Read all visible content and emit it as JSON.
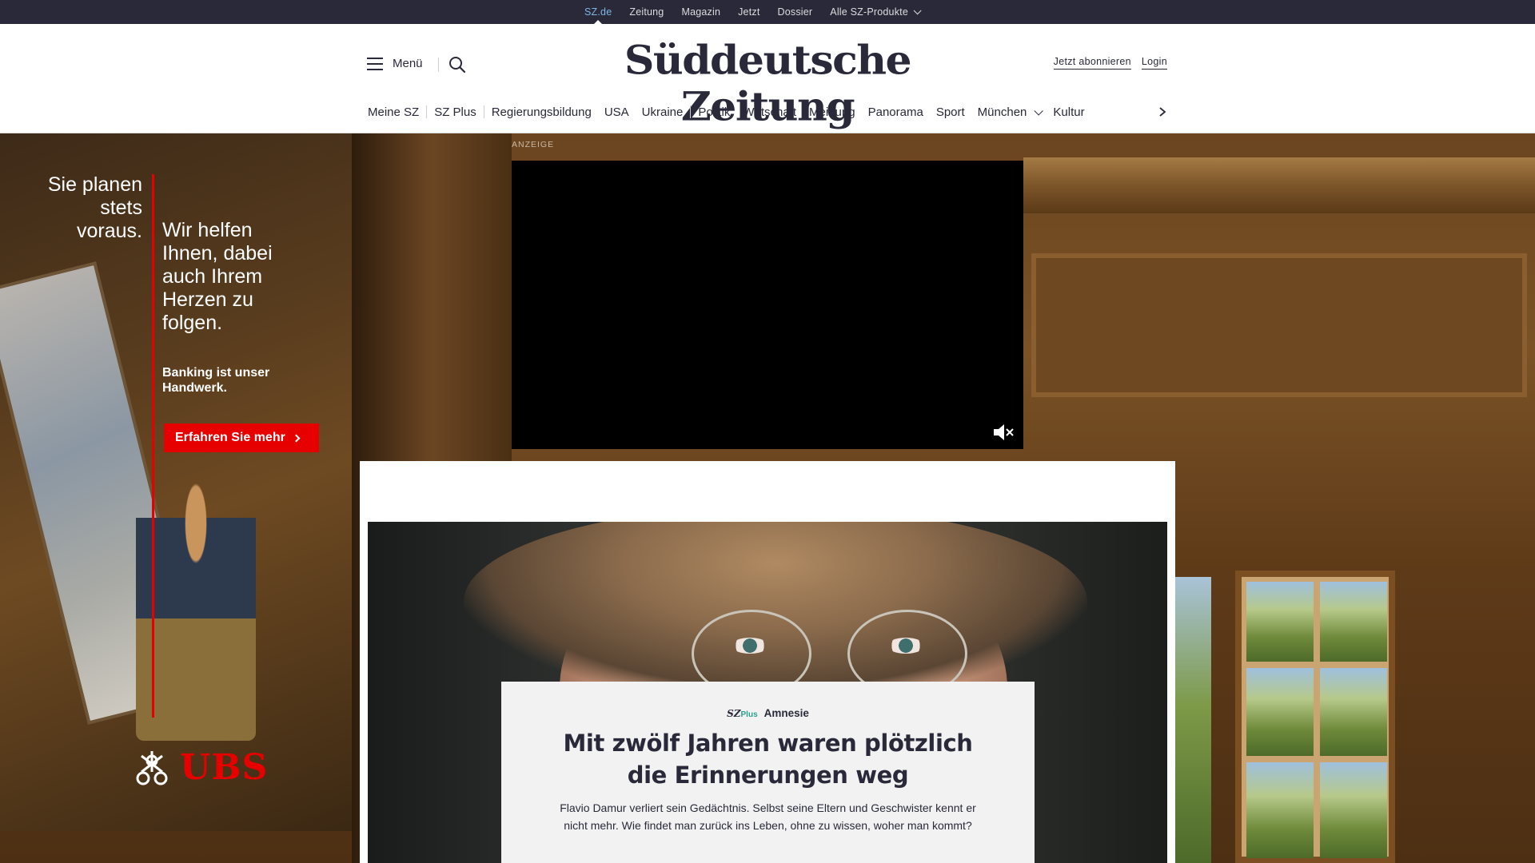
{
  "topbar": {
    "links": [
      "SZ.de",
      "Zeitung",
      "Magazin",
      "Jetzt",
      "Dossier",
      "Alle SZ-Produkte"
    ]
  },
  "header": {
    "menu_label": "Menü",
    "logo": "Süddeutsche Zeitung",
    "subscribe": "Jetzt abonnieren",
    "login": "Login"
  },
  "nav": {
    "items": [
      "Meine SZ",
      "SZ Plus",
      "Regierungsbildung",
      "USA",
      "Ukraine",
      "Politik",
      "Wirtschaft",
      "Meinung",
      "Panorama",
      "Sport",
      "München",
      "Kultur"
    ]
  },
  "ad_left": {
    "line_a": "Sie planen stets voraus.",
    "line_b": "Wir helfen Ihnen, dabei auch Ihrem Herzen zu folgen.",
    "line_c": "Banking ist unser Handwerk.",
    "cta": "Erfahren Sie mehr",
    "brand": "UBS",
    "brand_color": "#e60000"
  },
  "video_ad": {
    "label": "ANZEIGE"
  },
  "teaser": {
    "brand_sz": "SZ",
    "brand_plus": "Plus",
    "topic": "Amnesie",
    "headline": "Mit zwölf Jahren waren plötzlich die Erinnerungen weg",
    "text": "Flavio Damur verliert sein Gedächtnis. Selbst seine Eltern und Geschwister kennt er nicht mehr. Wie findet man zurück ins Leben, ohne zu wissen, woher man kommt?"
  },
  "colors": {
    "brand_dark": "#29293a",
    "accent_active": "#7fb6e3",
    "plus_green": "#2a9d8f"
  }
}
